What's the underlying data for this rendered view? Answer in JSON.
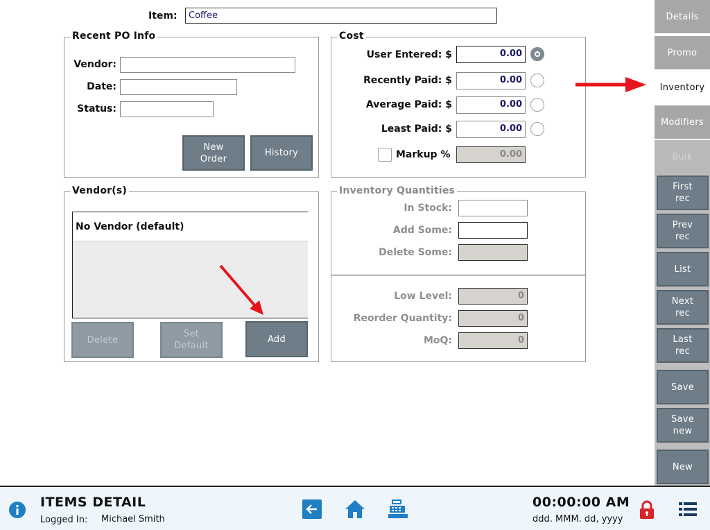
{
  "item": {
    "label": "Item:",
    "value": "Coffee"
  },
  "recent_po": {
    "title": "Recent PO Info",
    "vendor_label": "Vendor:",
    "vendor_value": "",
    "date_label": "Date:",
    "date_value": "",
    "status_label": "Status:",
    "status_value": "",
    "new_order_line1": "New",
    "new_order_line2": "Order",
    "history_label": "History"
  },
  "cost": {
    "title": "Cost",
    "user_entered_label": "User Entered: $",
    "user_entered_value": "0.00",
    "recently_paid_label": "Recently Paid: $",
    "recently_paid_value": "0.00",
    "average_paid_label": "Average Paid: $",
    "average_paid_value": "0.00",
    "least_paid_label": "Least Paid: $",
    "least_paid_value": "0.00",
    "markup_label": "Markup %",
    "markup_value": "0.00",
    "selected": "user_entered"
  },
  "vendors": {
    "title": "Vendor(s)",
    "items": [
      "No Vendor (default)"
    ],
    "delete_label": "Delete",
    "set_default_line1": "Set",
    "set_default_line2": "Default",
    "add_label": "Add"
  },
  "inventory": {
    "title": "Inventory Quantities",
    "in_stock_label": "In Stock:",
    "in_stock_value": "",
    "add_some_label": "Add Some:",
    "add_some_value": "",
    "delete_some_label": "Delete Some:",
    "delete_some_value": "",
    "low_level_label": "Low Level:",
    "low_level_value": "0",
    "reorder_label": "Reorder Quantity:",
    "reorder_value": "0",
    "moq_label": "MoQ:",
    "moq_value": "0"
  },
  "sidebar": {
    "tabs": [
      "Details",
      "Promo",
      "Inventory",
      "Modifiers",
      "Bulk"
    ],
    "active_tab": "Inventory",
    "buttons": [
      {
        "line1": "First",
        "line2": "rec"
      },
      {
        "line1": "Prev",
        "line2": "rec"
      },
      {
        "line1": "List",
        "line2": ""
      },
      {
        "line1": "Next",
        "line2": "rec"
      },
      {
        "line1": "Last",
        "line2": "rec"
      },
      {
        "line1": "Save",
        "line2": ""
      },
      {
        "line1": "Save",
        "line2": "new"
      },
      {
        "line1": "New",
        "line2": ""
      }
    ]
  },
  "footer": {
    "title": "ITEMS DETAIL",
    "logged_in_label": "Logged In:",
    "user": "Michael Smith",
    "time": "00:00:00 AM",
    "date": "ddd. MMM. dd, yyyy"
  },
  "colors": {
    "button": "#6e7d87",
    "annotation_arrow": "#e8141b",
    "tab_inactive": "#a7a7a7",
    "footer_bg": "#eef6fb",
    "icon_blue": "#1f7fc4",
    "lock_red": "#d8232a"
  },
  "icons": [
    "info-icon",
    "back-arrow-icon",
    "home-icon",
    "cash-register-icon",
    "lock-icon",
    "menu-list-icon"
  ]
}
